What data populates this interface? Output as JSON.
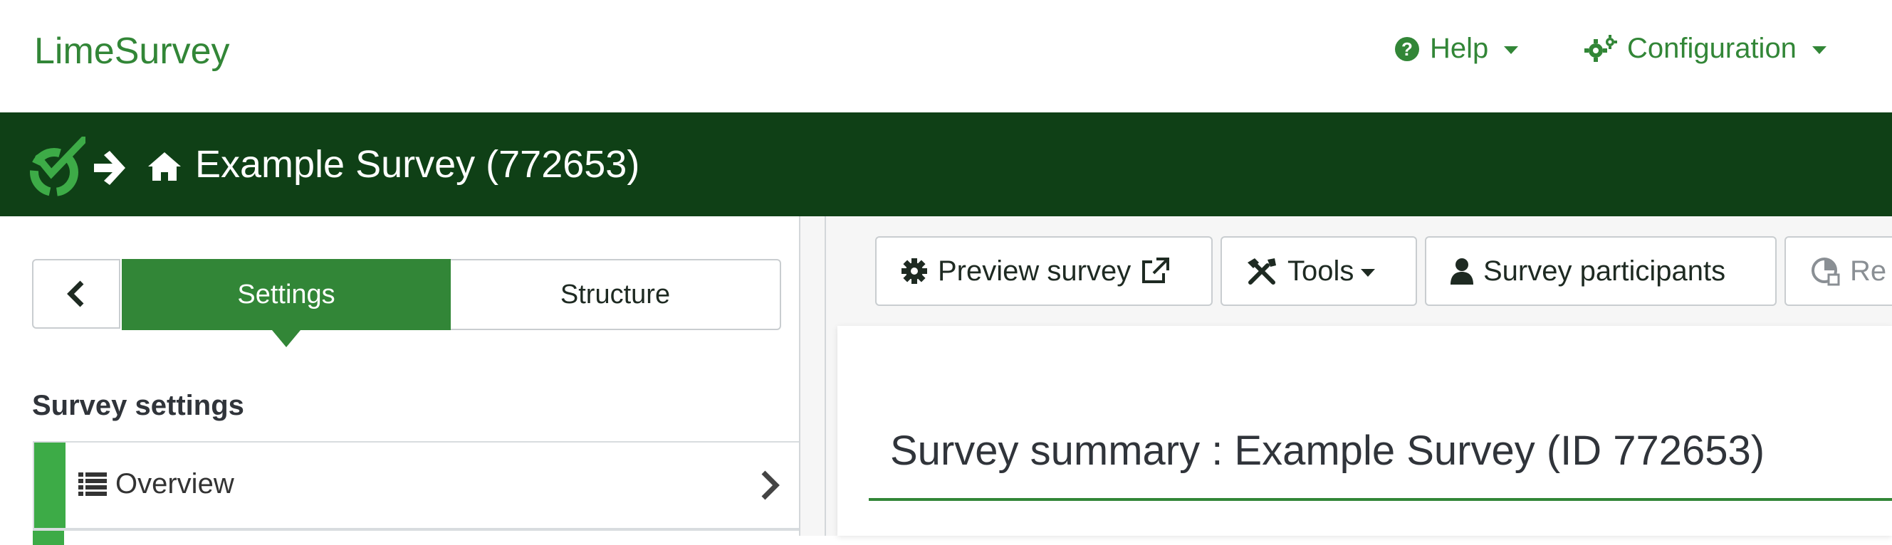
{
  "topbar": {
    "brand": "LimeSurvey",
    "help_label": "Help",
    "configuration_label": "Configuration"
  },
  "surveybar": {
    "title": "Example Survey (772653)"
  },
  "sidebar": {
    "tabs": [
      {
        "label": "Settings",
        "active": true
      },
      {
        "label": "Structure",
        "active": false
      }
    ],
    "section_heading": "Survey settings",
    "items": [
      {
        "label": "Overview",
        "icon": "list-icon",
        "active": true
      }
    ]
  },
  "toolbar": {
    "preview_label": "Preview survey",
    "tools_label": "Tools",
    "participants_label": "Survey participants",
    "responses_label": "Re"
  },
  "main": {
    "summary_title": "Survey summary : Example Survey (ID 772653)"
  },
  "colors": {
    "accent": "#328637",
    "header_dark": "#0f4016",
    "active_bar": "#3dab47"
  }
}
